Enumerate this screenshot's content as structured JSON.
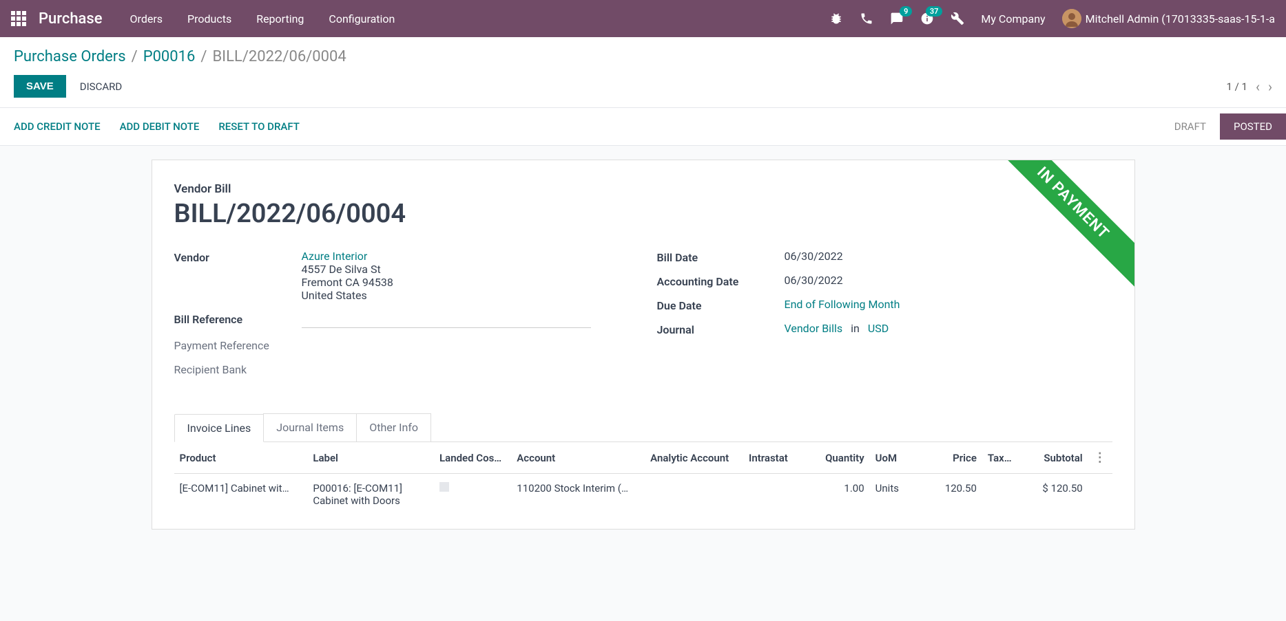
{
  "topbar": {
    "brand": "Purchase",
    "nav": [
      "Orders",
      "Products",
      "Reporting",
      "Configuration"
    ],
    "messages_badge": "9",
    "activities_badge": "37",
    "company": "My Company",
    "user": "Mitchell Admin (17013335-saas-15-1-a"
  },
  "breadcrumb": {
    "root": "Purchase Orders",
    "parent": "P00016",
    "current": "BILL/2022/06/0004"
  },
  "actions": {
    "save": "SAVE",
    "discard": "DISCARD",
    "pager": "1 / 1"
  },
  "statusbar": {
    "add_credit": "ADD CREDIT NOTE",
    "add_debit": "ADD DEBIT NOTE",
    "reset": "RESET TO DRAFT",
    "draft": "DRAFT",
    "posted": "POSTED"
  },
  "ribbon": "IN PAYMENT",
  "form": {
    "title_label": "Vendor Bill",
    "title": "BILL/2022/06/0004",
    "vendor_label": "Vendor",
    "vendor_name": "Azure Interior",
    "vendor_street": "4557 De Silva St",
    "vendor_city": "Fremont CA 94538",
    "vendor_country": "United States",
    "bill_ref_label": "Bill Reference",
    "pay_ref_label": "Payment Reference",
    "bank_label": "Recipient Bank",
    "bill_date_label": "Bill Date",
    "bill_date": "06/30/2022",
    "acc_date_label": "Accounting Date",
    "acc_date": "06/30/2022",
    "due_label": "Due Date",
    "due_value": "End of Following Month",
    "journal_label": "Journal",
    "journal_value": "Vendor Bills",
    "journal_in": "in",
    "journal_currency": "USD"
  },
  "tabs": {
    "invoice_lines": "Invoice Lines",
    "journal_items": "Journal Items",
    "other_info": "Other Info"
  },
  "table": {
    "headers": {
      "product": "Product",
      "label": "Label",
      "landed": "Landed Cos…",
      "account": "Account",
      "analytic": "Analytic Account",
      "intrastat": "Intrastat",
      "quantity": "Quantity",
      "uom": "UoM",
      "price": "Price",
      "tax": "Tax…",
      "subtotal": "Subtotal"
    },
    "row": {
      "product": "[E-COM11] Cabinet wit…",
      "label": "P00016: [E-COM11] Cabinet with Doors",
      "account": "110200 Stock Interim (…",
      "quantity": "1.00",
      "uom": "Units",
      "price": "120.50",
      "subtotal": "$ 120.50"
    }
  }
}
